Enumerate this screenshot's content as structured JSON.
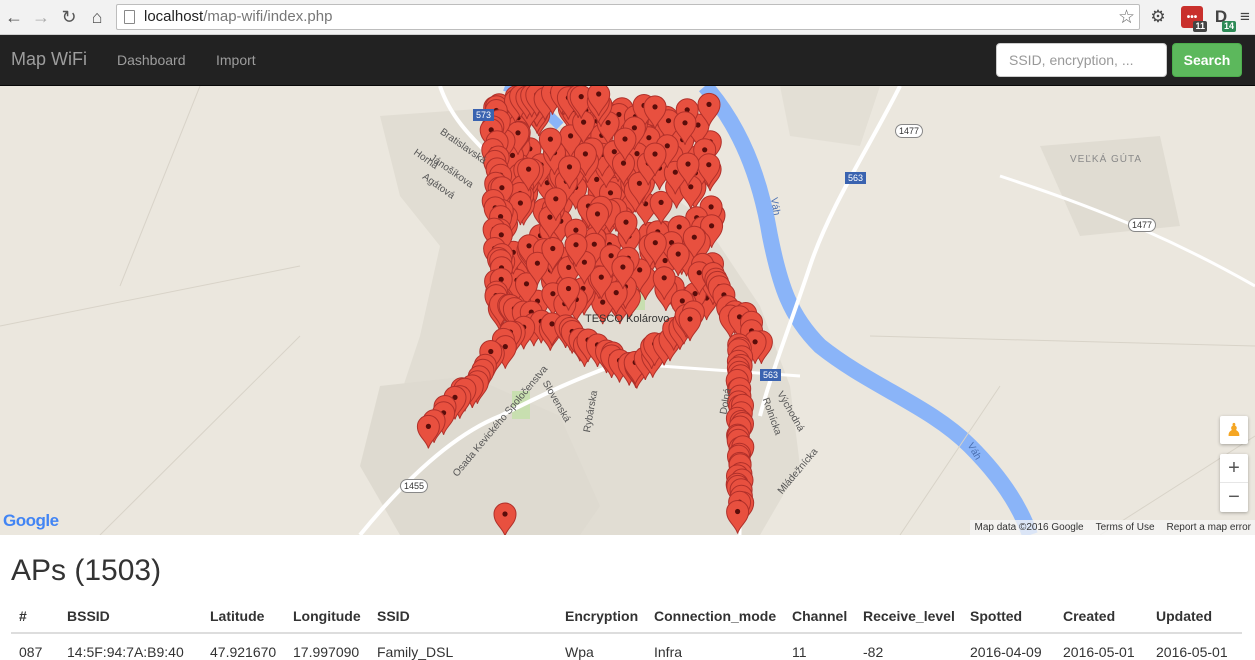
{
  "browser": {
    "url_host": "localhost",
    "url_path": "/map-wifi/index.php",
    "ext_badge_1": "11",
    "ext_badge_2": "14"
  },
  "navbar": {
    "brand": "Map WiFi",
    "links": [
      "Dashboard",
      "Import"
    ],
    "search_placeholder": "SSID, encryption, ...",
    "search_button": "Search"
  },
  "map": {
    "place_labels": {
      "bratislavska": "Bratislavská",
      "horna": "Horná",
      "janosikova": "Jánošíkova",
      "agatova": "Agátová",
      "tesco": "TESCO Kolárovo",
      "slovenska": "Slovenská",
      "rybarska": "Rybárska",
      "dolna": "Dolná",
      "rolnicka": "Rolnícka",
      "vychodna": "Východná",
      "mladeznicka": "Mládežnícka",
      "vah1": "Váh",
      "vah2": "Váh",
      "velka_guta": "VEĽKÁ GÚTA",
      "osada": "Osada Kevického Spoločenstva"
    },
    "route_labels": {
      "r1477a": "1477",
      "r1477b": "1477",
      "r563a": "563",
      "r563b": "563",
      "r1455": "1455",
      "r573": "573"
    },
    "google_logo": "Google",
    "footer": {
      "data": "Map data ©2016 Google",
      "terms": "Terms of Use",
      "report": "Report a map error"
    },
    "marker_color": "#e8503f"
  },
  "aps": {
    "title": "APs (1503)",
    "columns": [
      "#",
      "BSSID",
      "Latitude",
      "Longitude",
      "SSID",
      "Encryption",
      "Connection_mode",
      "Channel",
      "Receive_level",
      "Spotted",
      "Created",
      "Updated"
    ],
    "partial_row": [
      "087",
      "14:5F:94:7A:B9:40",
      "47.921670",
      "17.997090",
      "Family_DSL",
      "Wpa",
      "Infra",
      "11",
      "-82",
      "2016-04-09",
      "2016-05-01",
      "2016-05-01"
    ]
  }
}
